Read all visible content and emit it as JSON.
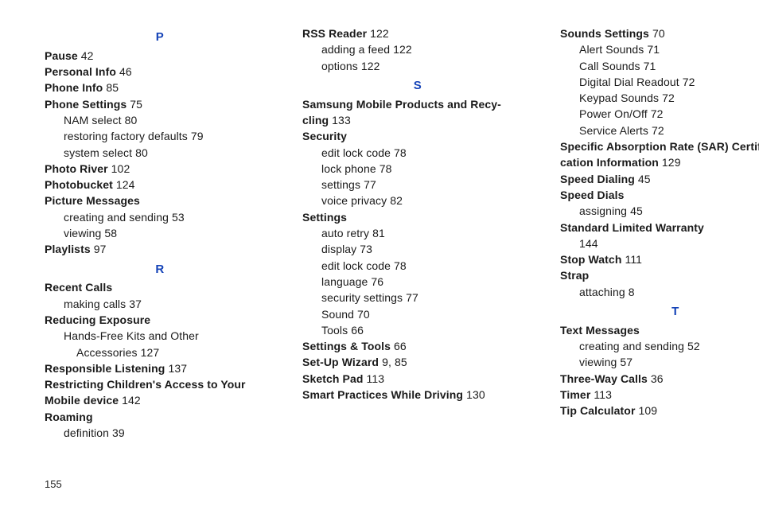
{
  "footer_page": "155",
  "columns": [
    {
      "items": [
        {
          "type": "letter",
          "text": "P"
        },
        {
          "type": "entry",
          "term": "Pause",
          "page": "42"
        },
        {
          "type": "entry",
          "term": "Personal Info",
          "page": "46"
        },
        {
          "type": "entry",
          "term": "Phone Info",
          "page": "85"
        },
        {
          "type": "entry",
          "term": "Phone Settings",
          "page": "75"
        },
        {
          "type": "sub",
          "text": "NAM select",
          "page": "80"
        },
        {
          "type": "sub",
          "text": "restoring factory defaults",
          "page": "79"
        },
        {
          "type": "sub",
          "text": "system select",
          "page": "80"
        },
        {
          "type": "entry",
          "term": "Photo River",
          "page": "102"
        },
        {
          "type": "entry",
          "term": "Photobucket",
          "page": "124"
        },
        {
          "type": "entry",
          "term": "Picture Messages"
        },
        {
          "type": "sub",
          "text": "creating and sending",
          "page": "53"
        },
        {
          "type": "sub",
          "text": "viewing",
          "page": "58"
        },
        {
          "type": "entry",
          "term": "Playlists",
          "page": "97"
        },
        {
          "type": "letter",
          "text": "R"
        },
        {
          "type": "entry",
          "term": "Recent Calls"
        },
        {
          "type": "sub",
          "text": "making calls",
          "page": "37"
        },
        {
          "type": "entry",
          "term": "Reducing Exposure"
        },
        {
          "type": "sub",
          "text": "Hands-Free Kits and Other"
        },
        {
          "type": "sub2",
          "text": "Accessories",
          "page": "127"
        },
        {
          "type": "entry",
          "term": "Responsible Listening",
          "page": "137"
        },
        {
          "type": "entry",
          "term": "Restricting Children's Access to Your"
        },
        {
          "type": "entrycont",
          "term": "Mobile device",
          "page": "142"
        },
        {
          "type": "entry",
          "term": "Roaming"
        },
        {
          "type": "sub",
          "text": "definition",
          "page": "39"
        }
      ]
    },
    {
      "items": [
        {
          "type": "entry",
          "term": "RSS Reader",
          "page": "122"
        },
        {
          "type": "sub",
          "text": "adding a feed",
          "page": "122"
        },
        {
          "type": "sub",
          "text": "options",
          "page": "122"
        },
        {
          "type": "letter",
          "text": "S"
        },
        {
          "type": "entry",
          "term": "Samsung Mobile Products and Recy-"
        },
        {
          "type": "entrycont",
          "term": "cling",
          "page": "133"
        },
        {
          "type": "entry",
          "term": "Security"
        },
        {
          "type": "sub",
          "text": "edit lock code",
          "page": "78"
        },
        {
          "type": "sub",
          "text": "lock phone",
          "page": "78"
        },
        {
          "type": "sub",
          "text": "settings",
          "page": "77"
        },
        {
          "type": "sub",
          "text": "voice privacy",
          "page": "82"
        },
        {
          "type": "entry",
          "term": "Settings"
        },
        {
          "type": "sub",
          "text": "auto retry",
          "page": "81"
        },
        {
          "type": "sub",
          "text": "display",
          "page": "73"
        },
        {
          "type": "sub",
          "text": "edit lock code",
          "page": "78"
        },
        {
          "type": "sub",
          "text": "language",
          "page": "76"
        },
        {
          "type": "sub",
          "text": "security settings",
          "page": "77"
        },
        {
          "type": "sub",
          "text": "Sound",
          "page": "70"
        },
        {
          "type": "sub",
          "text": "Tools",
          "page": "66"
        },
        {
          "type": "entry",
          "term": "Settings & Tools",
          "page": "66"
        },
        {
          "type": "entry",
          "term": "Set-Up Wizard",
          "page": "9,  85"
        },
        {
          "type": "entry",
          "term": "Sketch Pad",
          "page": "113"
        },
        {
          "type": "entry",
          "term": "Smart Practices While Driving",
          "page": "130"
        }
      ]
    },
    {
      "items": [
        {
          "type": "entry",
          "term": "Sounds Settings",
          "page": "70"
        },
        {
          "type": "sub",
          "text": "Alert Sounds",
          "page": "71"
        },
        {
          "type": "sub",
          "text": "Call Sounds",
          "page": "71"
        },
        {
          "type": "sub",
          "text": "Digital Dial Readout",
          "page": "72"
        },
        {
          "type": "sub",
          "text": "Keypad Sounds",
          "page": "72"
        },
        {
          "type": "sub",
          "text": "Power On/Off",
          "page": "72"
        },
        {
          "type": "sub",
          "text": "Service Alerts",
          "page": "72"
        },
        {
          "type": "entry",
          "term": "Specific Absorption Rate (SAR) Certifi-"
        },
        {
          "type": "entrycont",
          "term": "cation Information",
          "page": "129"
        },
        {
          "type": "entry",
          "term": "Speed Dialing",
          "page": "45"
        },
        {
          "type": "entry",
          "term": "Speed Dials"
        },
        {
          "type": "sub",
          "text": "assigning",
          "page": "45"
        },
        {
          "type": "entry",
          "term": "Standard Limited Warranty"
        },
        {
          "type": "sub",
          "text": "",
          "page": "144"
        },
        {
          "type": "entry",
          "term": "Stop Watch",
          "page": "111"
        },
        {
          "type": "entry",
          "term": "Strap"
        },
        {
          "type": "sub",
          "text": "attaching",
          "page": "8"
        },
        {
          "type": "letter",
          "text": "T"
        },
        {
          "type": "entry",
          "term": "Text Messages"
        },
        {
          "type": "sub",
          "text": "creating and sending",
          "page": "52"
        },
        {
          "type": "sub",
          "text": "viewing",
          "page": "57"
        },
        {
          "type": "entry",
          "term": "Three-Way Calls",
          "page": "36"
        },
        {
          "type": "entry",
          "term": "Timer",
          "page": "113"
        },
        {
          "type": "entry",
          "term": "Tip Calculator",
          "page": "109"
        }
      ]
    }
  ]
}
